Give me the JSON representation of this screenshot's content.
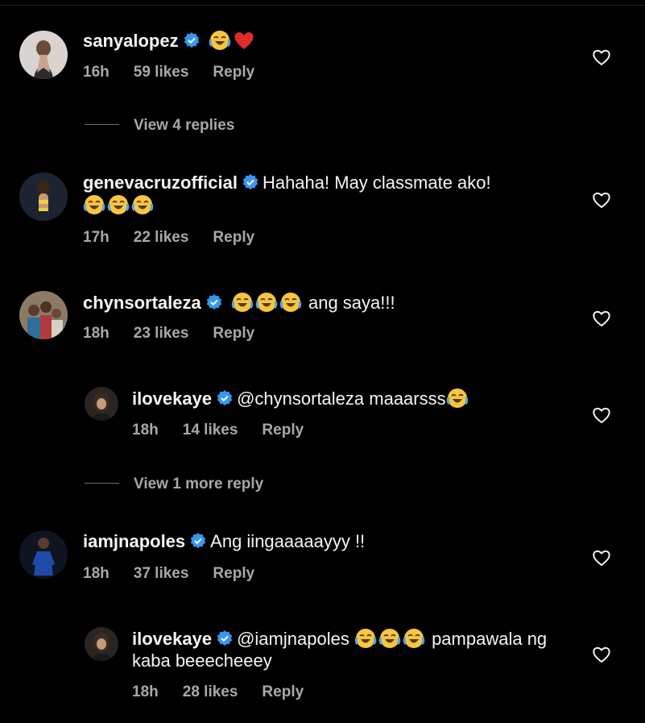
{
  "colors": {
    "background": "#000000",
    "text": "#f5f5f5",
    "muted": "#a8a8a8",
    "verified": "#3897f0"
  },
  "comments": [
    {
      "kind": "main",
      "username": "sanyalopez",
      "verified": true,
      "text_before": "",
      "emojis": [
        "face-with-tears-of-joy",
        "red-heart"
      ],
      "text_after": "",
      "time": "16h",
      "likes": "59 likes",
      "reply_label": "Reply"
    },
    {
      "kind": "main",
      "username": "genevacruzofficial",
      "verified": true,
      "text_before": "Hahaha! May classmate ako!",
      "emojis": [
        "face-with-tears-of-joy",
        "face-with-tears-of-joy",
        "face-with-tears-of-joy"
      ],
      "text_after": "",
      "time": "17h",
      "likes": "22 likes",
      "reply_label": "Reply"
    },
    {
      "kind": "main",
      "username": "chynsortaleza",
      "verified": true,
      "text_before": "",
      "emojis": [
        "face-with-tears-of-joy",
        "face-with-tears-of-joy",
        "face-with-tears-of-joy"
      ],
      "text_after": "ang saya!!!",
      "time": "18h",
      "likes": "23 likes",
      "reply_label": "Reply"
    },
    {
      "kind": "reply",
      "username": "ilovekaye",
      "verified": true,
      "text_before": "@chynsortaleza maaarsss",
      "emojis": [
        "face-with-tears-of-joy"
      ],
      "text_after": "",
      "time": "18h",
      "likes": "14 likes",
      "reply_label": "Reply"
    },
    {
      "kind": "main",
      "username": "iamjnapoles",
      "verified": true,
      "text_before": "Ang iingaaaaayyy !!",
      "emojis": [],
      "text_after": "",
      "time": "18h",
      "likes": "37 likes",
      "reply_label": "Reply"
    },
    {
      "kind": "reply",
      "username": "ilovekaye",
      "verified": true,
      "text_before": "@iamjnapoles",
      "emojis": [
        "face-with-tears-of-joy",
        "face-with-tears-of-joy",
        "face-with-tears-of-joy"
      ],
      "text_after": "pampawala ng kaba beeecheeey",
      "time": "18h",
      "likes": "28 likes",
      "reply_label": "Reply"
    }
  ],
  "view_replies": [
    {
      "label": "View 4 replies"
    },
    {
      "label": "View 1 more reply"
    }
  ]
}
